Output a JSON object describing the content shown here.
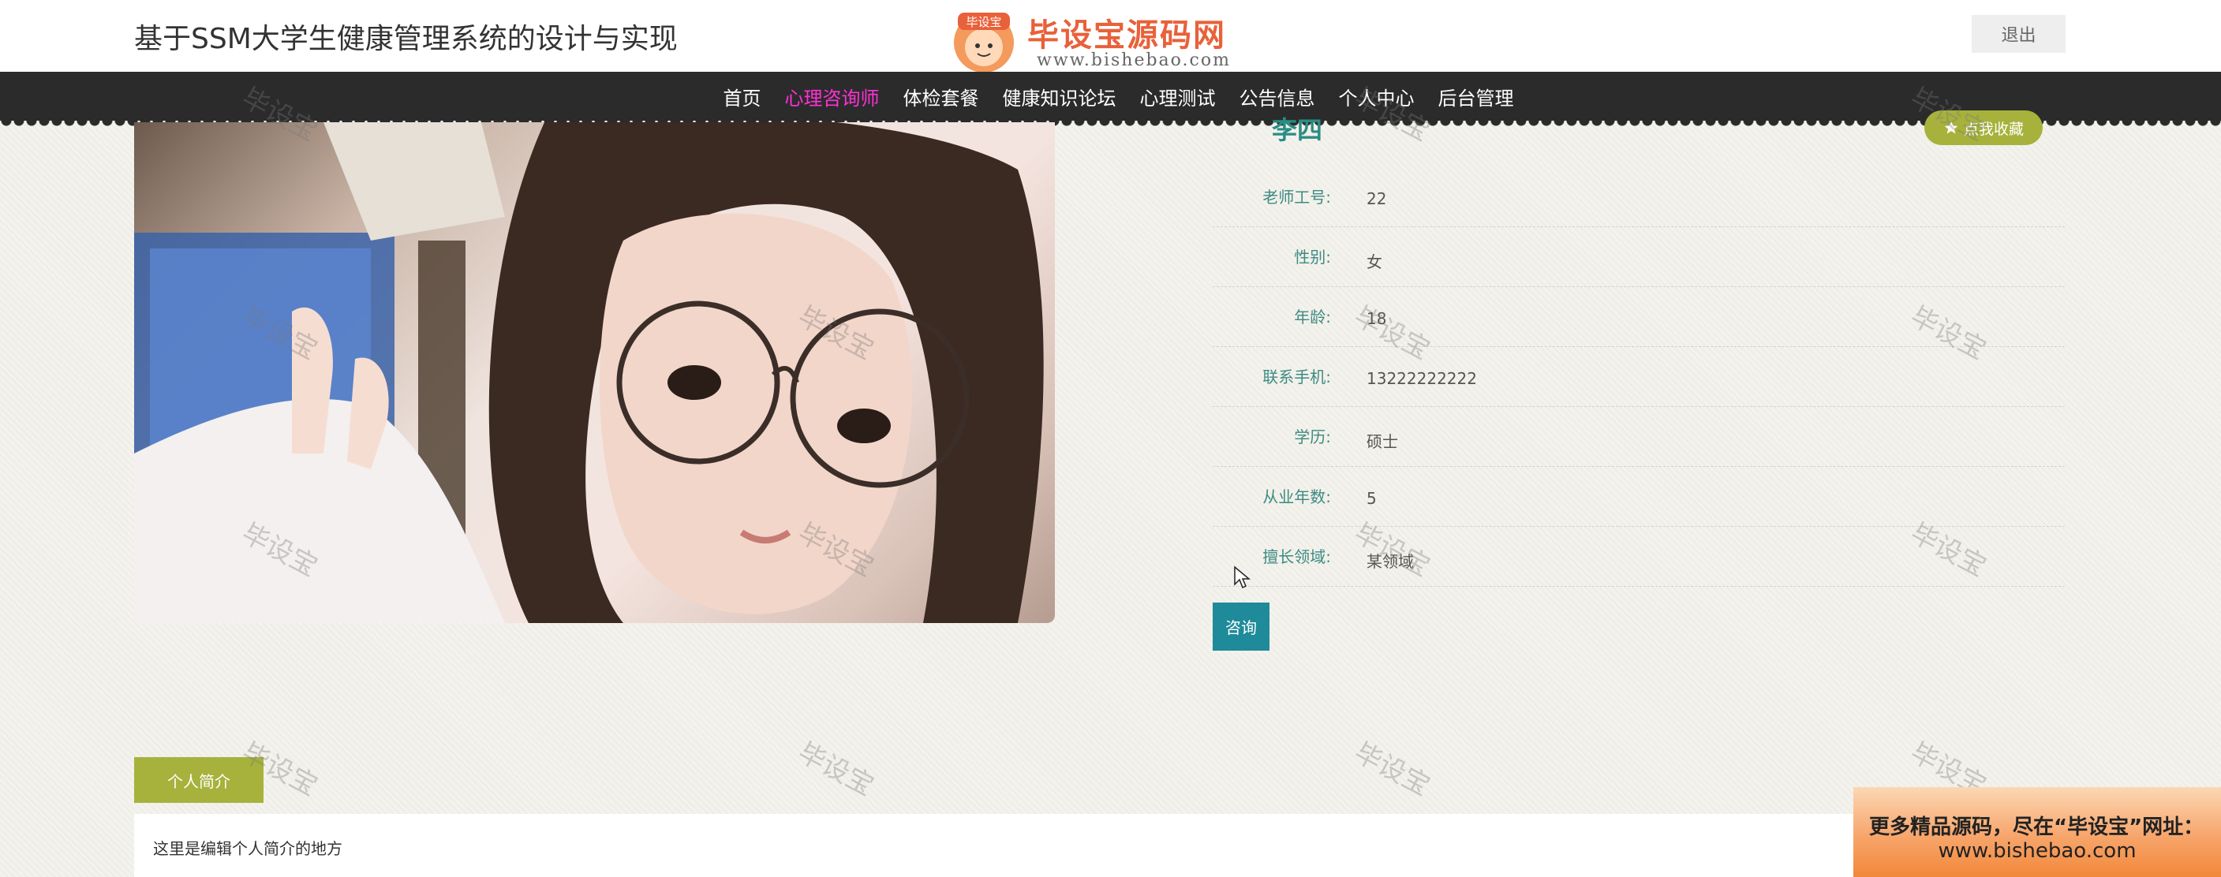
{
  "header": {
    "site_title": "基于SSM大学生健康管理系统的设计与实现",
    "logo_text": "毕设宝源码网",
    "logo_badge": "毕设宝",
    "logo_url": "www.bishebao.com",
    "logout_label": "退出"
  },
  "nav": {
    "items": [
      {
        "label": "首页",
        "active": false
      },
      {
        "label": "心理咨询师",
        "active": true
      },
      {
        "label": "体检套餐",
        "active": false
      },
      {
        "label": "健康知识论坛",
        "active": false
      },
      {
        "label": "心理测试",
        "active": false
      },
      {
        "label": "公告信息",
        "active": false
      },
      {
        "label": "个人中心",
        "active": false
      },
      {
        "label": "后台管理",
        "active": false
      }
    ],
    "active_color": "#ff30d6"
  },
  "detail": {
    "name": "李四",
    "favorite_label": "点我收藏",
    "fields": [
      {
        "label": "老师工号:",
        "value": "22"
      },
      {
        "label": "性别:",
        "value": "女"
      },
      {
        "label": "年龄:",
        "value": "18"
      },
      {
        "label": "联系手机:",
        "value": "13222222222"
      },
      {
        "label": "学历:",
        "value": "硕士"
      },
      {
        "label": "从业年数:",
        "value": "5"
      },
      {
        "label": "擅长领域:",
        "value": "某领域"
      }
    ],
    "consult_label": "咨询"
  },
  "intro": {
    "tab_label": "个人简介",
    "content": "这里是编辑个人简介的地方"
  },
  "watermark": "毕设宝",
  "promo": {
    "line1": "更多精品源码，尽在“毕设宝”网址：",
    "line2": "www.bishebao.com"
  },
  "colors": {
    "nav_bg": "#2b2b2b",
    "accent_green": "#a6b23b",
    "label_teal": "#3b8b82",
    "consult_blue": "#1e8a9a"
  },
  "icons": {
    "favorite": "star-icon",
    "cursor": "mouse-pointer-icon"
  }
}
